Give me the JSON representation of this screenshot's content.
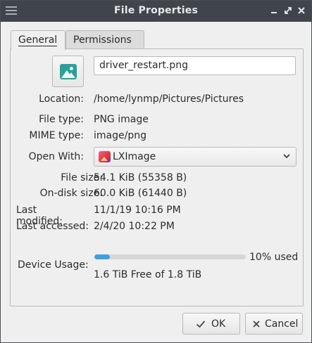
{
  "window": {
    "title": "File Properties"
  },
  "tabs": [
    {
      "label": "General",
      "active": true
    },
    {
      "label": "Permissions",
      "active": false
    }
  ],
  "general": {
    "icon": "image-file-icon",
    "file_name": "driver_restart.png",
    "location_label": "Location:",
    "location_value": "/home/lynmp/Pictures/Pictures",
    "filetype_label": "File type:",
    "filetype_value": "PNG image",
    "mime_label": "MIME type:",
    "mime_value": "image/png",
    "openwith_label": "Open With:",
    "openwith_value": "LXImage",
    "filesize_label": "File size:",
    "filesize_value": "54.1 KiB (55358 B)",
    "ondisk_label": "On-disk size:",
    "ondisk_value": "60.0 KiB (61440 B)",
    "modified_label": "Last modified:",
    "modified_value": "11/1/19 10:16 PM",
    "accessed_label": "Last accessed:",
    "accessed_value": "2/4/20 10:22 PM",
    "device_label": "Device Usage:",
    "device_used_pct": 10,
    "device_used_text": "10% used",
    "device_free_text": "1.6 TiB Free of 1.8 TiB"
  },
  "buttons": {
    "ok_label": "OK",
    "cancel_label": "Cancel"
  },
  "colors": {
    "titlebar": "#40454c",
    "progress": "#3da0e0",
    "image_icon": "#2aa198"
  }
}
